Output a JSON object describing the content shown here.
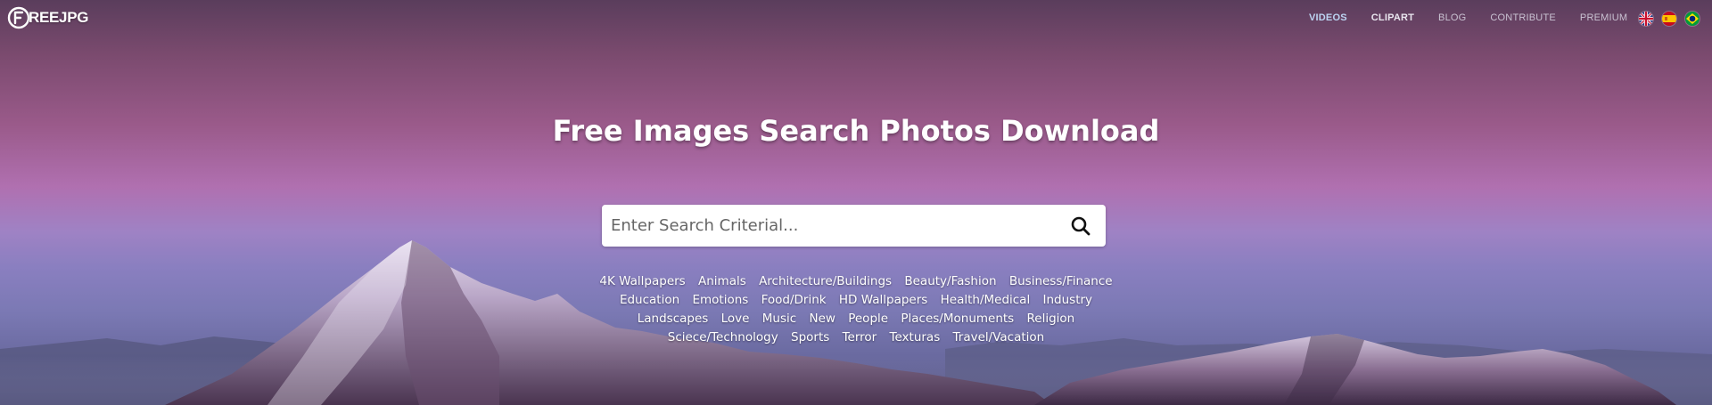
{
  "brand": {
    "logo_text": "REEJPG"
  },
  "nav": {
    "items": [
      {
        "label": "VIDEOS"
      },
      {
        "label": "CLIPART"
      },
      {
        "label": "BLOG"
      },
      {
        "label": "CONTRIBUTE"
      },
      {
        "label": "PREMIUM"
      }
    ],
    "flags": [
      {
        "icon": "uk-flag-icon"
      },
      {
        "icon": "spain-flag-icon"
      },
      {
        "icon": "brazil-flag-icon"
      }
    ]
  },
  "hero": {
    "title": "Free Images Search Photos Download"
  },
  "search": {
    "placeholder": "Enter Search Criterial...",
    "value": "",
    "icon": "search-icon"
  },
  "categories": [
    "4K Wallpapers",
    "Animals",
    "Architecture/Buildings",
    "Beauty/Fashion",
    "Business/Finance",
    "Education",
    "Emotions",
    "Food/Drink",
    "HD Wallpapers",
    "Health/Medical",
    "Industry",
    "Landscapes",
    "Love",
    "Music",
    "New",
    "People",
    "Places/Monuments",
    "Religion",
    "Sciece/Technology",
    "Sports",
    "Terror",
    "Texturas",
    "Travel/Vacation"
  ],
  "colors": {
    "nav_active": "#bcd4f2",
    "nav_text": "#c9c2d2",
    "title": "#ffffff"
  }
}
